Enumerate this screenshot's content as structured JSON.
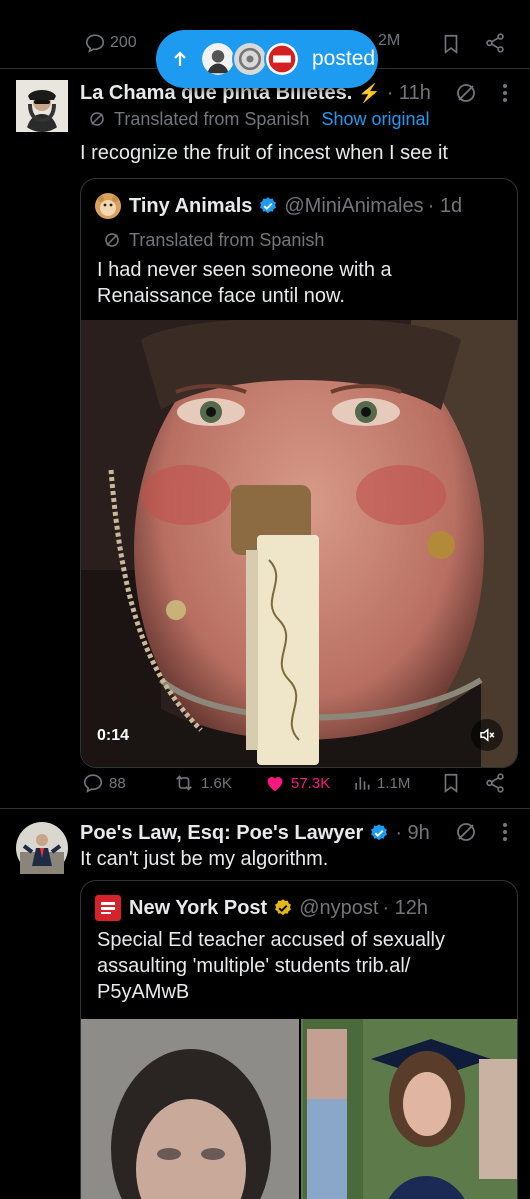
{
  "top_actions": {
    "replies": "200",
    "views": "2M"
  },
  "posted_pill": {
    "label": "posted"
  },
  "tweet1": {
    "author_name": "La Chama que pinta Billetes.",
    "emoji": "⚡",
    "time": "· 11h",
    "translated": "Translated from Spanish",
    "show_original": "Show original",
    "text": "I recognize the fruit of incest when I see it",
    "quote": {
      "author_name": "Tiny Animals",
      "handle": "@MiniAnimales",
      "time": "· 1d",
      "translated": "Translated from Spanish",
      "text": "I had never seen someone with a Renaissance face until now.",
      "video_time": "0:14"
    },
    "stats": {
      "replies": "88",
      "retweets": "1.6K",
      "likes": "57.3K",
      "views": "1.1M"
    }
  },
  "tweet2": {
    "author_name": "Poe's Law, Esq: Poe's Lawyer",
    "time": "· 9h",
    "text": "It can't just be my algorithm.",
    "quote": {
      "logo_text": "NEW YORK POST",
      "author_name": "New York Post",
      "handle": "@nypost",
      "time": "· 12h",
      "text": "Special Ed teacher accused of sexually assaulting 'multiple' students trib.al/ P5yAMwB"
    }
  },
  "colors": {
    "accent": "#1d9bf0",
    "like": "#f91880",
    "verified_gold": "#e2b719",
    "muted": "#71767b",
    "divider": "#2f3336"
  }
}
